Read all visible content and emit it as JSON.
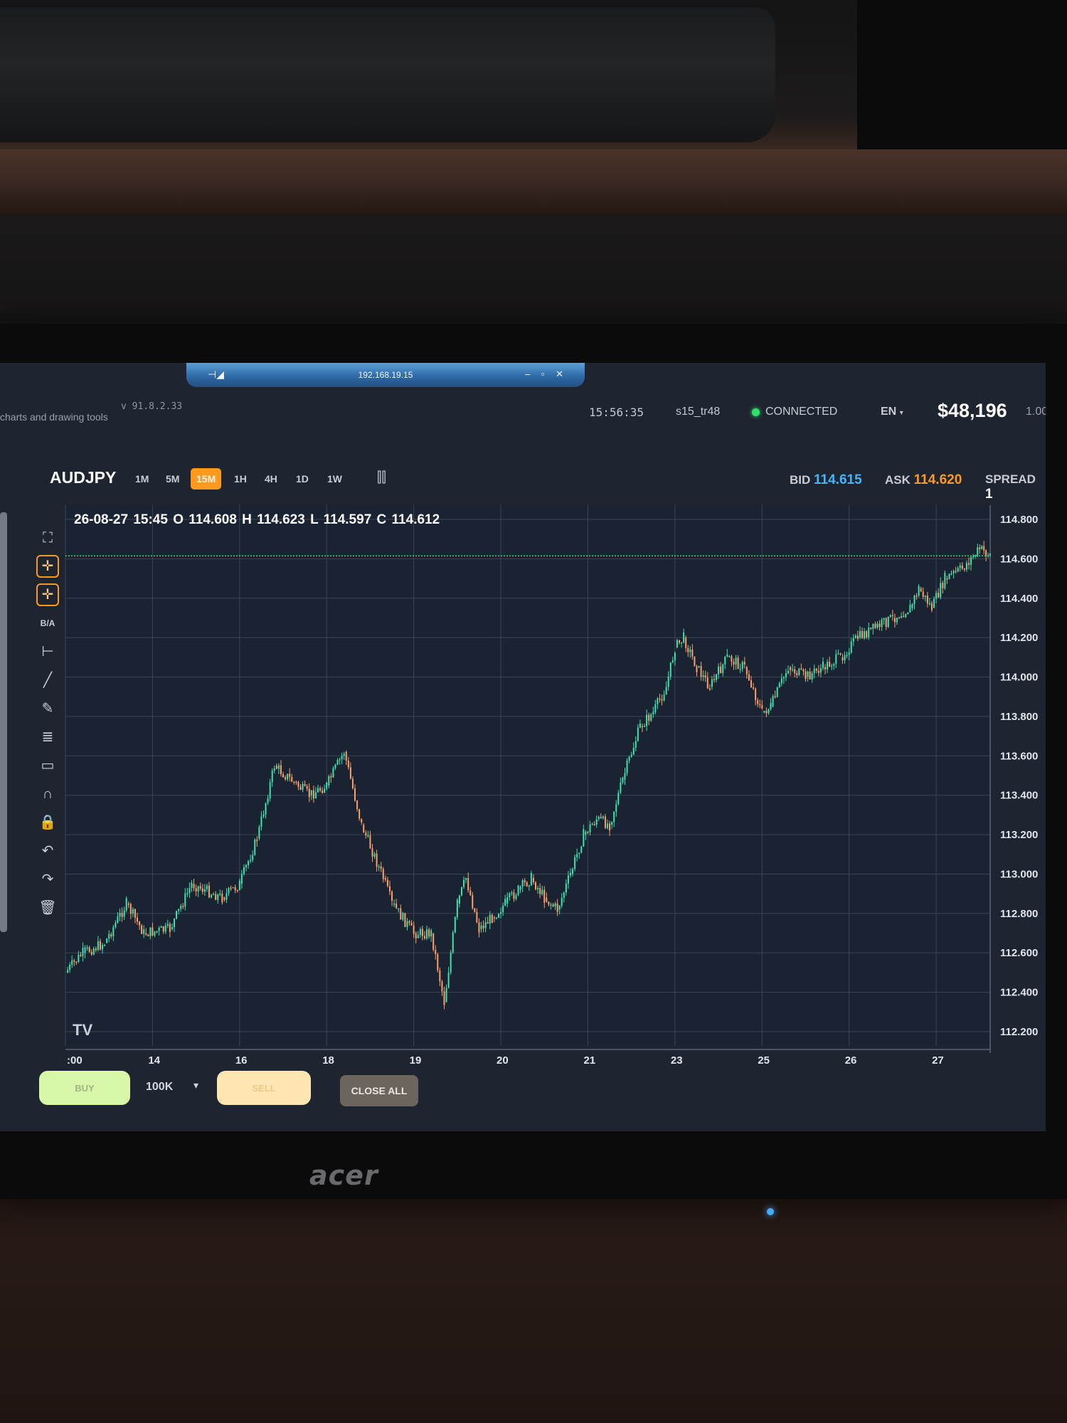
{
  "remote": {
    "ip": "192.168.19.15",
    "pin_icon": "pin-icon",
    "controls": "– ▫ ✕"
  },
  "header": {
    "subtitle": "charts and drawing tools",
    "version": "v 91.8.2.33",
    "clock": "15:56:35",
    "account": "s15_tr48",
    "connection": "CONNECTED",
    "language": "EN",
    "balance": "$48,196",
    "lots": "1.00"
  },
  "symbol_bar": {
    "symbol": "AUDJPY",
    "timeframes": [
      "1M",
      "5M",
      "15M",
      "1H",
      "4H",
      "1D",
      "1W"
    ],
    "active_timeframe": "15M",
    "chart_type_icon": "candlestick-icon",
    "bid_label": "BID",
    "bid": "114.615",
    "ask_label": "ASK",
    "ask": "114.620",
    "spread_label": "SPREAD",
    "spread": "1"
  },
  "ohlc": "26-08-27 15:45 O 114.608 H 114.623 L 114.597 C 114.612",
  "tools": [
    {
      "name": "fullscreen-icon",
      "glyph": "⛶"
    },
    {
      "name": "crosshair-icon",
      "glyph": "✛",
      "selected": true
    },
    {
      "name": "magnet-crosshair-icon",
      "glyph": "✛",
      "selected": true
    },
    {
      "name": "bid-ask-toggle",
      "glyph": "B/A",
      "text": true
    },
    {
      "name": "horizontal-line-icon",
      "glyph": "⊢"
    },
    {
      "name": "trend-line-icon",
      "glyph": "╱"
    },
    {
      "name": "pencil-icon",
      "glyph": "✎"
    },
    {
      "name": "fibonacci-icon",
      "glyph": "≣"
    },
    {
      "name": "rectangle-icon",
      "glyph": "▭"
    },
    {
      "name": "magnet-icon",
      "glyph": "∩"
    },
    {
      "name": "lock-icon",
      "glyph": "🔒"
    },
    {
      "name": "undo-icon",
      "glyph": "↶"
    },
    {
      "name": "redo-icon",
      "glyph": "↷"
    },
    {
      "name": "trash-icon",
      "glyph": "🗑"
    }
  ],
  "trade": {
    "buy_label": "BUY",
    "lot_size": "100K",
    "sell_label": "SELL",
    "close_all_label": "CLOSE ALL"
  },
  "colors": {
    "up": "#3ee3b0",
    "down": "#ff9f6a",
    "accent": "#ff9a1e",
    "bid": "#3fb8ff",
    "price_line": "#2ee06a"
  },
  "chart_data": {
    "type": "line",
    "title": "",
    "xlabel": "",
    "ylabel": "",
    "ylim": [
      112.2,
      114.8
    ],
    "y_ticks": [
      "114.800",
      "114.600",
      "114.400",
      "114.200",
      "114.000",
      "113.800",
      "113.600",
      "113.400",
      "113.200",
      "113.000",
      "112.800",
      "112.600",
      "112.400",
      "112.200"
    ],
    "x_ticks": [
      {
        "label": ":00",
        "x": 0
      },
      {
        "label": "14",
        "x": 1
      },
      {
        "label": "16",
        "x": 2
      },
      {
        "label": "18",
        "x": 3
      },
      {
        "label": "19",
        "x": 4
      },
      {
        "label": "20",
        "x": 5
      },
      {
        "label": "21",
        "x": 6
      },
      {
        "label": "23",
        "x": 7
      },
      {
        "label": "25",
        "x": 8
      },
      {
        "label": "26",
        "x": 9
      },
      {
        "label": "27",
        "x": 10
      }
    ],
    "current_price": 114.615,
    "watermark": "TV",
    "series": [
      {
        "x": [
          0,
          0.2,
          0.45,
          0.7,
          0.9,
          1.2,
          1.45,
          1.8,
          2.0,
          2.2,
          2.4,
          2.8,
          3.0,
          3.2,
          3.4,
          3.65,
          3.75,
          4.0,
          4.2,
          4.35,
          4.5,
          4.6,
          4.75,
          4.9,
          5.05,
          5.2,
          5.35,
          5.5,
          5.65,
          5.8,
          5.95,
          6.1,
          6.25,
          6.4,
          6.6,
          6.75,
          6.9,
          7.0,
          7.1,
          7.25,
          7.4,
          7.6,
          7.8,
          8.0,
          8.1,
          8.3,
          8.5,
          8.7,
          8.9,
          9.1,
          9.3,
          9.5,
          9.7,
          9.8,
          9.95,
          10.1,
          10.3,
          10.5,
          10.62
        ],
        "values": [
          112.5,
          112.6,
          112.65,
          112.85,
          112.7,
          112.72,
          112.95,
          112.88,
          112.95,
          113.18,
          113.55,
          113.4,
          113.45,
          113.62,
          113.25,
          112.98,
          112.85,
          112.7,
          112.7,
          112.35,
          112.85,
          112.98,
          112.72,
          112.78,
          112.85,
          112.92,
          112.98,
          112.88,
          112.82,
          113.0,
          113.2,
          113.28,
          113.25,
          113.48,
          113.75,
          113.82,
          113.95,
          114.15,
          114.2,
          114.05,
          113.95,
          114.1,
          114.05,
          113.82,
          113.85,
          114.05,
          114.0,
          114.05,
          114.1,
          114.2,
          114.25,
          114.3,
          114.35,
          114.45,
          114.35,
          114.5,
          114.55,
          114.65,
          114.62
        ]
      }
    ]
  }
}
